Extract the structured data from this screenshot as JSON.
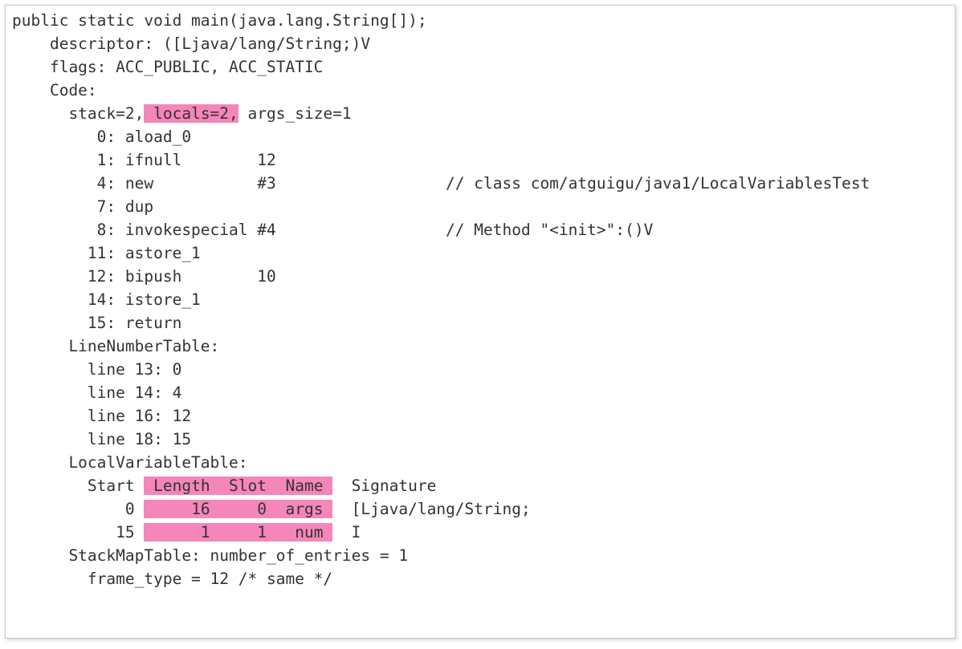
{
  "sig": "public static void main(java.lang.String[]);",
  "desc": "    descriptor: ([Ljava/lang/String;)V",
  "flags": "    flags: ACC_PUBLIC, ACC_STATIC",
  "codeLabel": "    Code:",
  "stack_pre": "      stack=2,",
  "stack_hl": " locals=2,",
  "stack_post": " args_size=1",
  "bc0": "         0: aload_0",
  "bc1": "         1: ifnull        12",
  "bc4": "         4: new           #3                  // class com/atguigu/java1/LocalVariablesTest",
  "bc7": "         7: dup",
  "bc8": "         8: invokespecial #4                  // Method \"<init>\":()V",
  "bc11": "        11: astore_1",
  "bc12": "        12: bipush        10",
  "bc14": "        14: istore_1",
  "bc15": "        15: return",
  "lntLabel": "      LineNumberTable:",
  "lnt13": "        line 13: 0",
  "lnt14": "        line 14: 4",
  "lnt16": "        line 16: 12",
  "lnt18": "        line 18: 15",
  "lvtLabel": "      LocalVariableTable:",
  "lvt_h_pre": "        Start ",
  "lvt_h_hl": " Length  Slot  Name ",
  "lvt_h_post": "  Signature",
  "lvt_r0_pre": "            0 ",
  "lvt_r0_hl": "     16     0  args ",
  "lvt_r0_post": "  [Ljava/lang/String;",
  "lvt_r1_pre": "           15 ",
  "lvt_r1_hl": "      1     1   num ",
  "lvt_r1_post": "  I",
  "smt": "      StackMapTable: number_of_entries = 1",
  "ft": "        frame_type = 12 /* same */"
}
